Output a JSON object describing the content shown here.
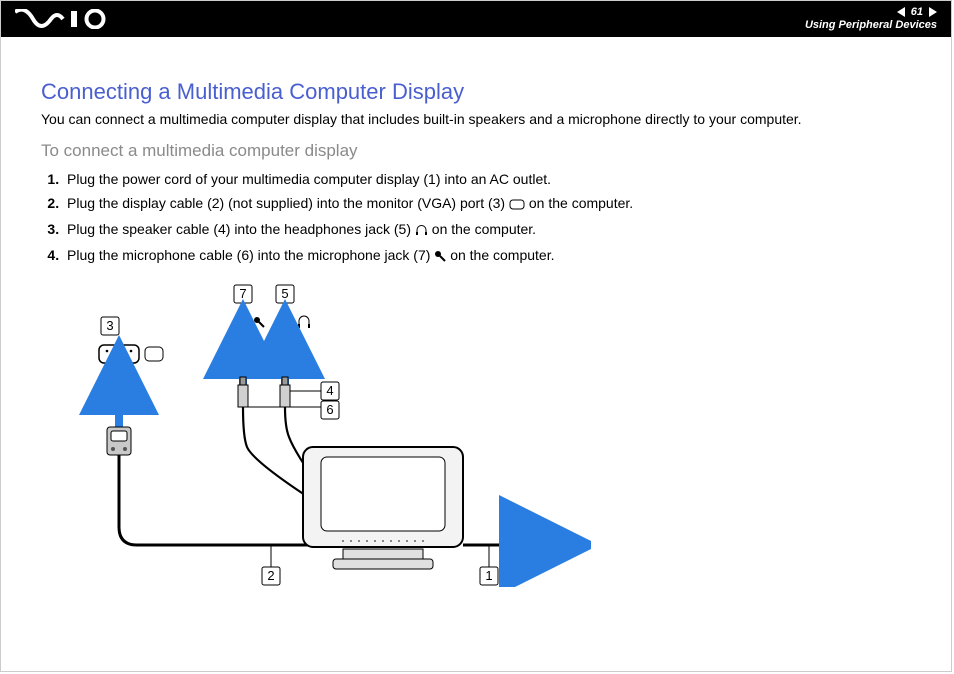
{
  "header": {
    "page_number": "61",
    "section": "Using Peripheral Devices",
    "logo_alt": "VAIO"
  },
  "title": "Connecting a Multimedia Computer Display",
  "lede": "You can connect a multimedia computer display that includes built-in speakers and a microphone directly to your computer.",
  "subhead": "To connect a multimedia computer display",
  "steps": [
    {
      "pre": "Plug the power cord of your multimedia computer display (1) into an AC outlet.",
      "icon": "",
      "post": ""
    },
    {
      "pre": "Plug the display cable (2) (not supplied) into the monitor (VGA) port (3) ",
      "icon": "vga",
      "post": " on the computer."
    },
    {
      "pre": "Plug the speaker cable (4) into the headphones jack (5) ",
      "icon": "headphones",
      "post": " on the computer."
    },
    {
      "pre": "Plug the microphone cable (6) into the microphone jack (7) ",
      "icon": "mic",
      "post": " on the computer."
    }
  ],
  "callouts": {
    "1": "1",
    "2": "2",
    "3": "3",
    "4": "4",
    "5": "5",
    "6": "6",
    "7": "7"
  }
}
